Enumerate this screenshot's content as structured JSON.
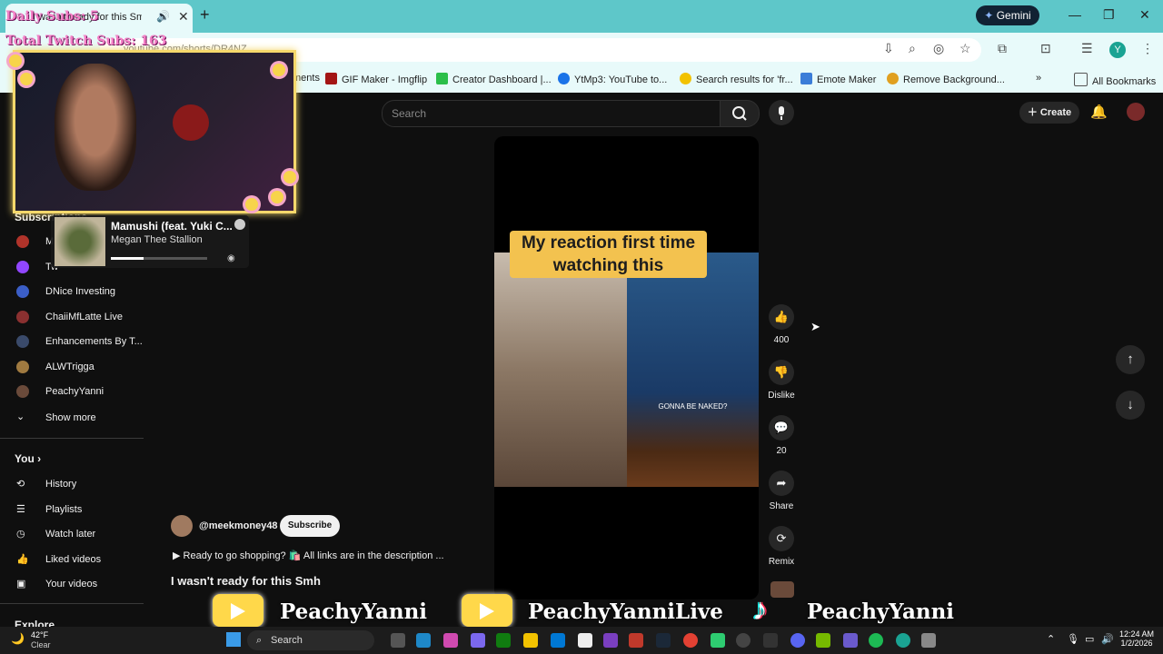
{
  "browser": {
    "tab_title": "I wasn't ready for this Sm",
    "url": "youtube.com/shorts/DR4NZ...",
    "gemini_label": "Gemini",
    "bookmarks": [
      "ments",
      "GIF Maker - Imgflip",
      "Creator Dashboard |...",
      "YtMp3: YouTube to...",
      "Search results for 'fr...",
      "Emote Maker",
      "Remove Background..."
    ],
    "all_bookmarks": "All Bookmarks",
    "profile_initial": "Y"
  },
  "overlay": {
    "daily_subs": "Daily Subs: 5",
    "total_subs": "Total Twitch Subs: 163",
    "song_title": "Mamushi (feat. Yuki C...",
    "song_artist": "Megan Thee Stallion",
    "song_progress_fraction": 0.34,
    "banner": [
      "PeachyYanni",
      "PeachyYanniLive",
      "PeachyYanni"
    ]
  },
  "youtube": {
    "search_placeholder": "Search",
    "create_label": "Create",
    "sidebar": {
      "subscriptions_heading": "Subscriptions",
      "subscriptions": [
        "M",
        "Tw",
        "DNice Investing",
        "ChaiiMfLatte Live",
        "Enhancements By T...",
        "ALWTrigga",
        "PeachyYanni"
      ],
      "show_more": "Show more",
      "you_heading": "You",
      "you_items": [
        "History",
        "Playlists",
        "Watch later",
        "Liked videos",
        "Your videos"
      ],
      "explore_heading": "Explore"
    },
    "short": {
      "caption": "My reaction first time watching this",
      "onscreen_text": "GONNA BE NAKED?",
      "channel": "@meekmoney48",
      "subscribe_label": "Subscribe",
      "description": "Ready to go shopping? 🛍️ All links are in the description ...",
      "title": "I wasn't ready for this Smh"
    },
    "actions": {
      "like_count": "400",
      "dislike_label": "Dislike",
      "comment_count": "20",
      "share_label": "Share",
      "remix_label": "Remix"
    }
  },
  "taskbar": {
    "temp": "42°F",
    "condition": "Clear",
    "search_label": "Search",
    "time": "12:24 AM",
    "date": "1/2/2026"
  }
}
